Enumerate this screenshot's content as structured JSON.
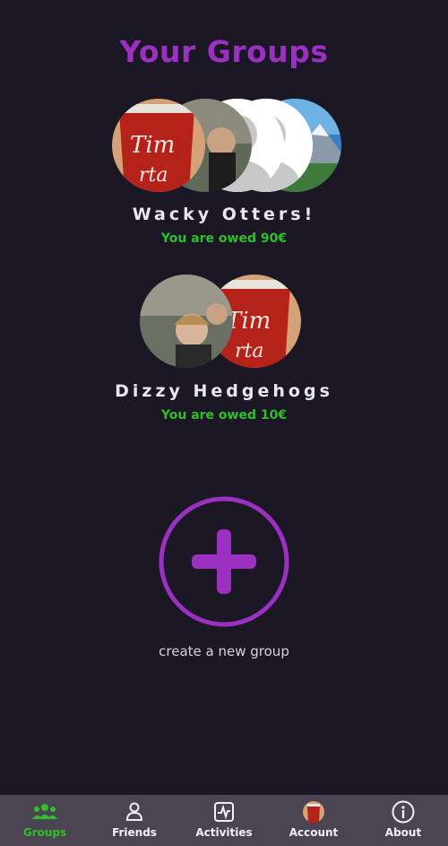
{
  "page": {
    "title": "Your Groups"
  },
  "groups": [
    {
      "name": "Wacky Otters!",
      "owed_text": "You are owed 90€",
      "avatars": [
        "tim-hortons-cup-photo",
        "selfie-photo",
        "default-user-icon",
        "default-user-icon",
        "mountain-landscape-photo"
      ]
    },
    {
      "name": "Dizzy Hedgehogs",
      "owed_text": "You are owed 10€",
      "avatars": [
        "selfie-photo",
        "tim-hortons-cup-photo"
      ]
    }
  ],
  "create_group": {
    "label": "create a new group",
    "icon": "plus-circle-icon"
  },
  "navbar": {
    "items": [
      {
        "label": "Groups",
        "icon": "groups-icon",
        "active": true
      },
      {
        "label": "Friends",
        "icon": "person-icon",
        "active": false
      },
      {
        "label": "Activities",
        "icon": "activity-icon",
        "active": false
      },
      {
        "label": "Account",
        "icon": "account-avatar-icon",
        "active": false
      },
      {
        "label": "About",
        "icon": "info-icon",
        "active": false
      }
    ]
  },
  "colors": {
    "background": "#1c1724",
    "accent_purple": "#9b30c2",
    "owed_green": "#2fbf2a",
    "navbar_bg": "#4b4553"
  }
}
